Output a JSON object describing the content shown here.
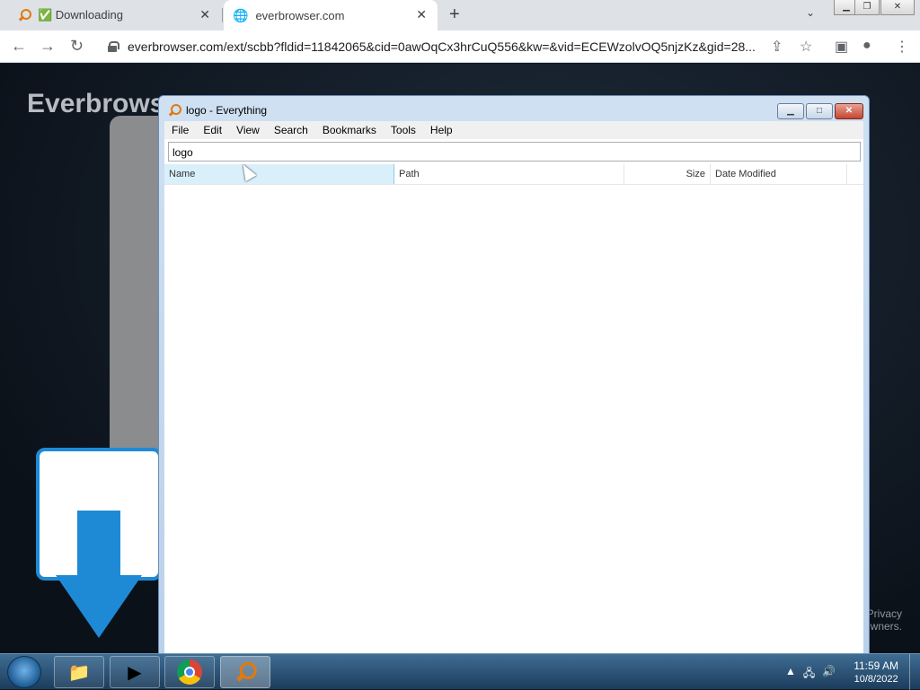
{
  "browser": {
    "tabs": [
      {
        "label": "✅ Downloading",
        "icon": "magnifier-icon"
      },
      {
        "label": "everbrowser.com",
        "icon": "globe-icon"
      }
    ],
    "address": "everbrowser.com/ext/scbb?fldid=11842065&cid=0awOqCx3hrCuQ556&kw=&vid=ECEWzolvOQ5njzKz&gid=28..."
  },
  "page": {
    "brand": "Everbrows",
    "footer_line1": "Privacy",
    "footer_line2": "wners."
  },
  "everything": {
    "title": "logo - Everything",
    "menu": [
      "File",
      "Edit",
      "View",
      "Search",
      "Bookmarks",
      "Tools",
      "Help"
    ],
    "search_value": "logo",
    "columns": {
      "name": "Name",
      "path": "Path",
      "size": "Size",
      "date": "Date Modified"
    }
  },
  "taskbar": {
    "time": "11:59 AM",
    "date": "10/8/2022"
  },
  "colors": {
    "accent": "#1e8ad6",
    "taskbar": "#2a5478"
  }
}
